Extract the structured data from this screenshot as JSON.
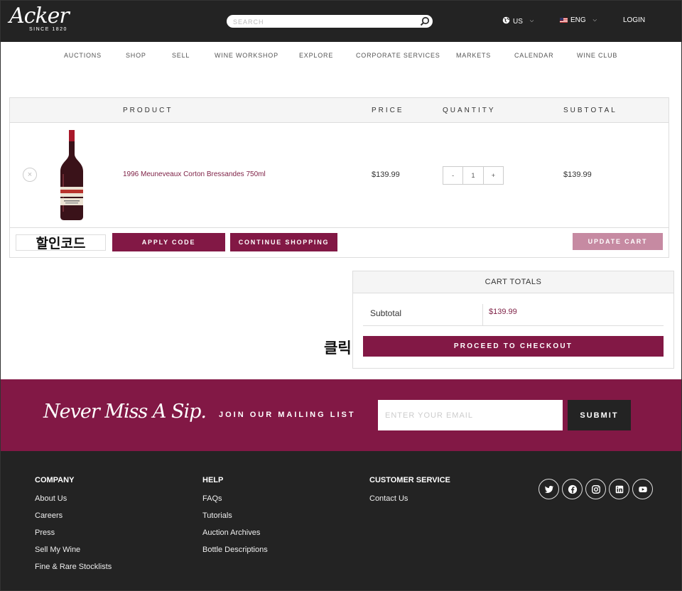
{
  "header": {
    "logo_text": "Acker",
    "logo_since": "SINCE 1820",
    "search_placeholder": "SEARCH",
    "region": "US",
    "language": "ENG",
    "login": "LOGIN"
  },
  "nav": [
    "AUCTIONS",
    "SHOP",
    "SELL",
    "WINE WORKSHOP",
    "EXPLORE",
    "CORPORATE SERVICES",
    "MARKETS",
    "CALENDAR",
    "WINE CLUB"
  ],
  "cart": {
    "columns": {
      "product": "PRODUCT",
      "price": "PRICE",
      "quantity": "QUANTITY",
      "subtotal": "SUBTOTAL"
    },
    "items": [
      {
        "name": "1996 Meuneveaux Corton Bressandes 750ml",
        "price": "$139.99",
        "quantity": "1",
        "subtotal": "$139.99"
      }
    ],
    "coupon_label": "할인코드",
    "apply_code": "APPLY CODE",
    "continue_shopping": "CONTINUE SHOPPING",
    "update_cart": "UPDATE CART",
    "qty_minus": "-",
    "qty_plus": "+",
    "remove_icon": "×"
  },
  "totals": {
    "title": "CART TOTALS",
    "subtotal_label": "Subtotal",
    "subtotal_value": "$139.99",
    "checkout": "PROCEED TO CHECKOUT",
    "annotation": "클릭"
  },
  "mailing": {
    "tagline": "Never Miss A Sip.",
    "join": "JOIN OUR MAILING LIST",
    "email_placeholder": "ENTER YOUR EMAIL",
    "submit": "SUBMIT"
  },
  "footer": {
    "company": {
      "title": "COMPANY",
      "links": [
        "About Us",
        "Careers",
        "Press",
        "Sell My Wine",
        "Fine & Rare Stocklists"
      ]
    },
    "help": {
      "title": "HELP",
      "links": [
        "FAQs",
        "Tutorials",
        "Auction Archives",
        "Bottle Descriptions"
      ]
    },
    "service": {
      "title": "CUSTOMER SERVICE",
      "links": [
        "Contact Us"
      ]
    },
    "social": [
      "twitter-icon",
      "facebook-icon",
      "instagram-icon",
      "linkedin-icon",
      "youtube-icon"
    ]
  },
  "colors": {
    "brand": "#821845",
    "dark": "#232323",
    "update_button": "#c68aa2"
  }
}
